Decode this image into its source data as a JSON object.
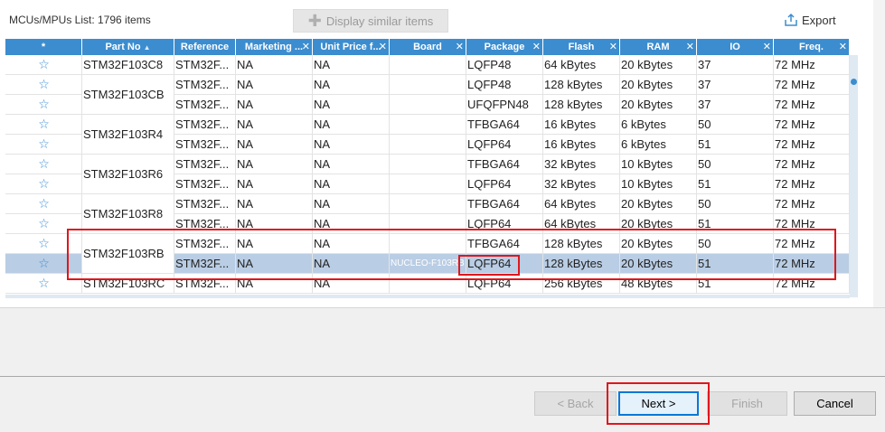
{
  "list_title": "MCUs/MPUs List: 1796 items",
  "display_similar_label": "Display similar items",
  "export_label": "Export",
  "columns": [
    {
      "label": "*",
      "w": 85,
      "x": false
    },
    {
      "label": "Part No",
      "w": 102,
      "x": false
    },
    {
      "label": "Reference",
      "w": 68,
      "x": false
    },
    {
      "label": "Marketing ...",
      "w": 85,
      "x": true
    },
    {
      "label": "Unit Price f...",
      "w": 85,
      "x": true
    },
    {
      "label": "Board",
      "w": 85,
      "x": true
    },
    {
      "label": "Package",
      "w": 85,
      "x": true
    },
    {
      "label": "Flash",
      "w": 85,
      "x": true
    },
    {
      "label": "RAM",
      "w": 85,
      "x": true
    },
    {
      "label": "IO",
      "w": 85,
      "x": true
    },
    {
      "label": "Freq.",
      "w": 84,
      "x": true
    }
  ],
  "rows": [
    {
      "ref": "STM32F...",
      "mkt": "NA",
      "price": "NA",
      "board": "",
      "pkg": "LQFP48",
      "flash": "64 kBytes",
      "ram": "20 kBytes",
      "io": "37",
      "freq": "72 MHz"
    },
    {
      "ref": "STM32F...",
      "mkt": "NA",
      "price": "NA",
      "board": "",
      "pkg": "LQFP48",
      "flash": "128 kBytes",
      "ram": "20 kBytes",
      "io": "37",
      "freq": "72 MHz"
    },
    {
      "ref": "STM32F...",
      "mkt": "NA",
      "price": "NA",
      "board": "",
      "pkg": "UFQFPN48",
      "flash": "128 kBytes",
      "ram": "20 kBytes",
      "io": "37",
      "freq": "72 MHz"
    },
    {
      "ref": "STM32F...",
      "mkt": "NA",
      "price": "NA",
      "board": "",
      "pkg": "TFBGA64",
      "flash": "16 kBytes",
      "ram": "6 kBytes",
      "io": "50",
      "freq": "72 MHz"
    },
    {
      "ref": "STM32F...",
      "mkt": "NA",
      "price": "NA",
      "board": "",
      "pkg": "LQFP64",
      "flash": "16 kBytes",
      "ram": "6 kBytes",
      "io": "51",
      "freq": "72 MHz"
    },
    {
      "ref": "STM32F...",
      "mkt": "NA",
      "price": "NA",
      "board": "",
      "pkg": "TFBGA64",
      "flash": "32 kBytes",
      "ram": "10 kBytes",
      "io": "50",
      "freq": "72 MHz"
    },
    {
      "ref": "STM32F...",
      "mkt": "NA",
      "price": "NA",
      "board": "",
      "pkg": "LQFP64",
      "flash": "32 kBytes",
      "ram": "10 kBytes",
      "io": "51",
      "freq": "72 MHz"
    },
    {
      "ref": "STM32F...",
      "mkt": "NA",
      "price": "NA",
      "board": "",
      "pkg": "TFBGA64",
      "flash": "64 kBytes",
      "ram": "20 kBytes",
      "io": "50",
      "freq": "72 MHz"
    },
    {
      "ref": "STM32F...",
      "mkt": "NA",
      "price": "NA",
      "board": "",
      "pkg": "LQFP64",
      "flash": "64 kBytes",
      "ram": "20 kBytes",
      "io": "51",
      "freq": "72 MHz"
    },
    {
      "ref": "STM32F...",
      "mkt": "NA",
      "price": "NA",
      "board": "",
      "pkg": "TFBGA64",
      "flash": "128 kBytes",
      "ram": "20 kBytes",
      "io": "50",
      "freq": "72 MHz"
    },
    {
      "ref": "STM32F...",
      "mkt": "NA",
      "price": "NA",
      "board": "NUCLEO-F103RB",
      "pkg": "LQFP64",
      "flash": "128 kBytes",
      "ram": "20 kBytes",
      "io": "51",
      "freq": "72 MHz",
      "selected": true
    },
    {
      "ref": "STM32F...",
      "mkt": "NA",
      "price": "NA",
      "board": "",
      "pkg": "LQFP64",
      "flash": "256 kBytes",
      "ram": "48 kBytes",
      "io": "51",
      "freq": "72 MHz"
    }
  ],
  "part_groups": [
    {
      "label": "STM32F103C8",
      "start": 0,
      "span": 1
    },
    {
      "label": "STM32F103CB",
      "start": 1,
      "span": 2
    },
    {
      "label": "STM32F103R4",
      "start": 3,
      "span": 2
    },
    {
      "label": "STM32F103R6",
      "start": 5,
      "span": 2
    },
    {
      "label": "STM32F103R8",
      "start": 7,
      "span": 2
    },
    {
      "label": "STM32F103RB",
      "start": 9,
      "span": 2
    },
    {
      "label": "STM32F103RC",
      "start": 11,
      "span": 1
    }
  ],
  "buttons": {
    "back": "< Back",
    "next": "Next >",
    "finish": "Finish",
    "cancel": "Cancel"
  },
  "colors": {
    "header": "#3c8dcf",
    "selected_row": "#b9cde4",
    "highlight": "#e0161b"
  }
}
